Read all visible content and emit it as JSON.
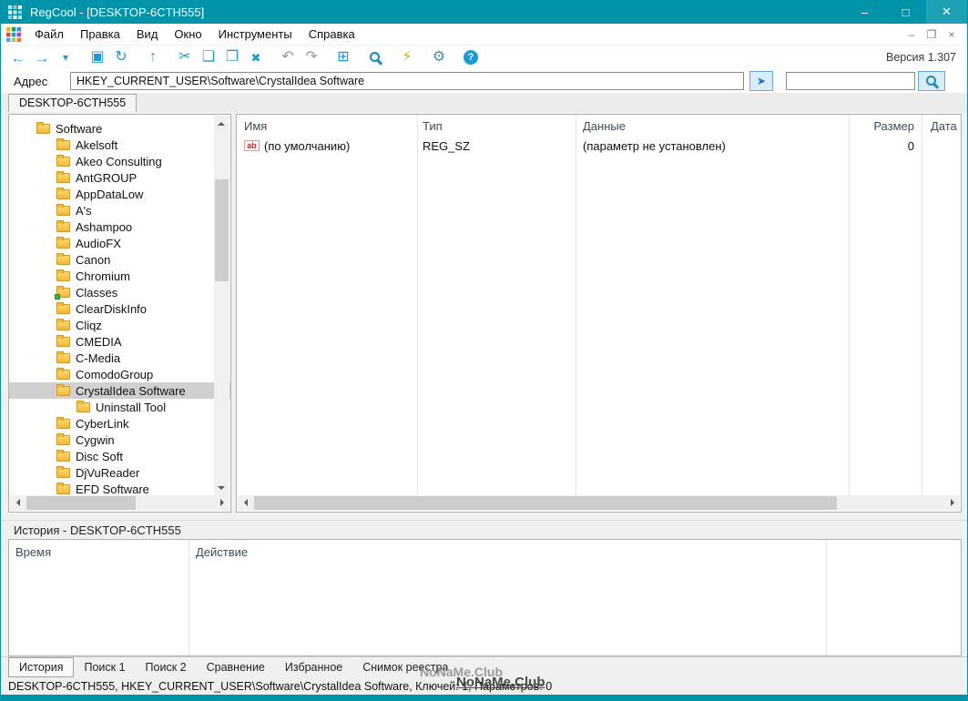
{
  "window": {
    "title": "RegCool - [DESKTOP-6CTH555]",
    "accent_color": "#0094ab",
    "controls": [
      {
        "name": "minimize-button",
        "glyph": "–"
      },
      {
        "name": "maximize-button",
        "glyph": "□"
      },
      {
        "name": "close-button",
        "glyph": "✕"
      }
    ]
  },
  "menu": {
    "items": [
      "Файл",
      "Правка",
      "Вид",
      "Окно",
      "Инструменты",
      "Справка"
    ],
    "mdi_controls": [
      {
        "name": "mdi-minimize-button",
        "glyph": "–"
      },
      {
        "name": "mdi-restore-button",
        "glyph": "❐"
      },
      {
        "name": "mdi-close-button",
        "glyph": "×"
      }
    ]
  },
  "toolbar": {
    "version_label": "Версия 1.307",
    "items": [
      {
        "name": "back-icon",
        "glyph": "←",
        "color": "#1a9bd7",
        "size": 17
      },
      {
        "name": "forward-icon",
        "glyph": "→",
        "color": "#1a9bd7",
        "size": 17
      },
      {
        "name": "nav-history-dropdown-icon",
        "glyph": "▾",
        "color": "#1a9bd7",
        "size": 12
      },
      {
        "sep": true
      },
      {
        "name": "remote-computer-icon",
        "glyph": "▣",
        "color": "#1a9bd7"
      },
      {
        "name": "refresh-icon",
        "glyph": "↻",
        "color": "#1a9bd7"
      },
      {
        "sep": true
      },
      {
        "name": "parent-key-icon",
        "glyph": "↑",
        "color": "#1a9bd7"
      },
      {
        "sep": true
      },
      {
        "name": "cut-icon",
        "glyph": "✂",
        "color": "#1a9bd7"
      },
      {
        "name": "copy-icon",
        "glyph": "❏",
        "color": "#1a9bd7"
      },
      {
        "name": "paste-icon",
        "glyph": "❐",
        "color": "#1a9bd7"
      },
      {
        "name": "delete-icon",
        "glyph": "✖",
        "color": "#1a9bd7",
        "size": 13
      },
      {
        "sep": true
      },
      {
        "name": "undo-icon",
        "glyph": "↶",
        "color": "#9b9b9b"
      },
      {
        "name": "redo-icon",
        "glyph": "↷",
        "color": "#9b9b9b"
      },
      {
        "sep": true
      },
      {
        "name": "new-window-icon",
        "glyph": "⊞",
        "color": "#1a9bd7"
      },
      {
        "sep": true
      },
      {
        "name": "search-icon",
        "css": "magnifier"
      },
      {
        "sep": true
      },
      {
        "name": "jump-flash-icon",
        "glyph": "⚡",
        "color": "#e8a020"
      },
      {
        "sep": true
      },
      {
        "name": "settings-gear-icon",
        "glyph": "⚙",
        "color": "#4a90b8"
      },
      {
        "sep": true
      },
      {
        "name": "help-icon",
        "css": "help"
      }
    ]
  },
  "address": {
    "label": "Адрес",
    "value": "HKEY_CURRENT_USER\\Software\\CrystalIdea Software",
    "go_button_glyph": "➤",
    "search_value": ""
  },
  "registry_tab": {
    "label": "DESKTOP-6CTH555"
  },
  "tree": {
    "items": [
      {
        "label": "Software",
        "level": 0,
        "expanded": true
      },
      {
        "label": "Akelsoft",
        "level": 1
      },
      {
        "label": "Akeo Consulting",
        "level": 1
      },
      {
        "label": "AntGROUP",
        "level": 1
      },
      {
        "label": "AppDataLow",
        "level": 1
      },
      {
        "label": "A's",
        "level": 1
      },
      {
        "label": "Ashampoo",
        "level": 1
      },
      {
        "label": "AudioFX",
        "level": 1
      },
      {
        "label": "Canon",
        "level": 1
      },
      {
        "label": "Chromium",
        "level": 1
      },
      {
        "label": "Classes",
        "level": 1,
        "badge": true
      },
      {
        "label": "ClearDiskInfo",
        "level": 1
      },
      {
        "label": "Cliqz",
        "level": 1
      },
      {
        "label": "CMEDIA",
        "level": 1
      },
      {
        "label": "C-Media",
        "level": 1
      },
      {
        "label": "ComodoGroup",
        "level": 1
      },
      {
        "label": "CrystalIdea Software",
        "level": 1,
        "selected": true
      },
      {
        "label": "Uninstall Tool",
        "level": 2
      },
      {
        "label": "CyberLink",
        "level": 1
      },
      {
        "label": "Cygwin",
        "level": 1
      },
      {
        "label": "Disc Soft",
        "level": 1
      },
      {
        "label": "DjVuReader",
        "level": 1
      },
      {
        "label": "EFD Software",
        "level": 1
      }
    ]
  },
  "list": {
    "columns": [
      "Имя",
      "Тип",
      "Данные",
      "Размер",
      "Дата"
    ],
    "rows": [
      {
        "icon": "string-value-icon",
        "icon_text": "ab",
        "name": "(по умолчанию)",
        "type": "REG_SZ",
        "data": "(параметр не установлен)",
        "size": "0",
        "date": ""
      }
    ]
  },
  "history": {
    "title": "История - DESKTOP-6CTH555",
    "columns": [
      "Время",
      "Действие"
    ]
  },
  "bottom_tabs": {
    "items": [
      "История",
      "Поиск 1",
      "Поиск 2",
      "Сравнение",
      "Избранное",
      "Снимок реестра"
    ],
    "active": "История"
  },
  "status": {
    "text": "DESKTOP-6CTH555, HKEY_CURRENT_USER\\Software\\CrystalIdea Software, Ключей: 1, Параметров: 0",
    "watermark": "NoNaMe.Club"
  }
}
